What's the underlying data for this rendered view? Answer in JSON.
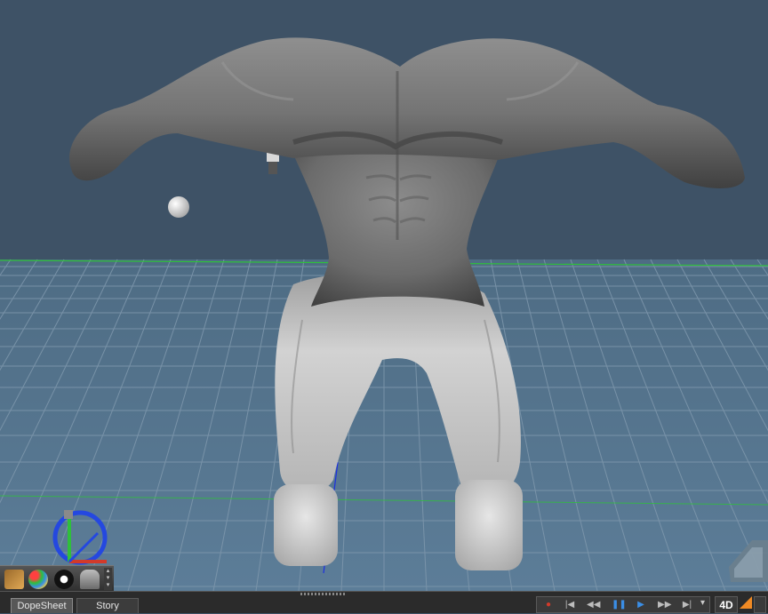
{
  "tabs": [
    {
      "label": "DopeSheet",
      "active": true
    },
    {
      "label": "Story",
      "active": false
    }
  ],
  "transport": {
    "record": "●",
    "go_start": "|◀",
    "step_back": "◀◀",
    "pause": "❚❚",
    "play": "▶",
    "step_forward": "▶▶",
    "go_end": "▶|",
    "menu": "▾"
  },
  "mode_label": "4D",
  "tool_icons": [
    "hair-tool-icon",
    "color-palette-icon",
    "tire-icon",
    "character-figure-icon"
  ],
  "colors": {
    "viewport_background": "#3e5266",
    "grid_line": "#7f98ad",
    "horizon_line": "#2fbf3c",
    "model_surface": "#a9a9a9",
    "record": "#d23a2a",
    "play": "#3a8ee6",
    "mode_accent": "#f08a24"
  }
}
